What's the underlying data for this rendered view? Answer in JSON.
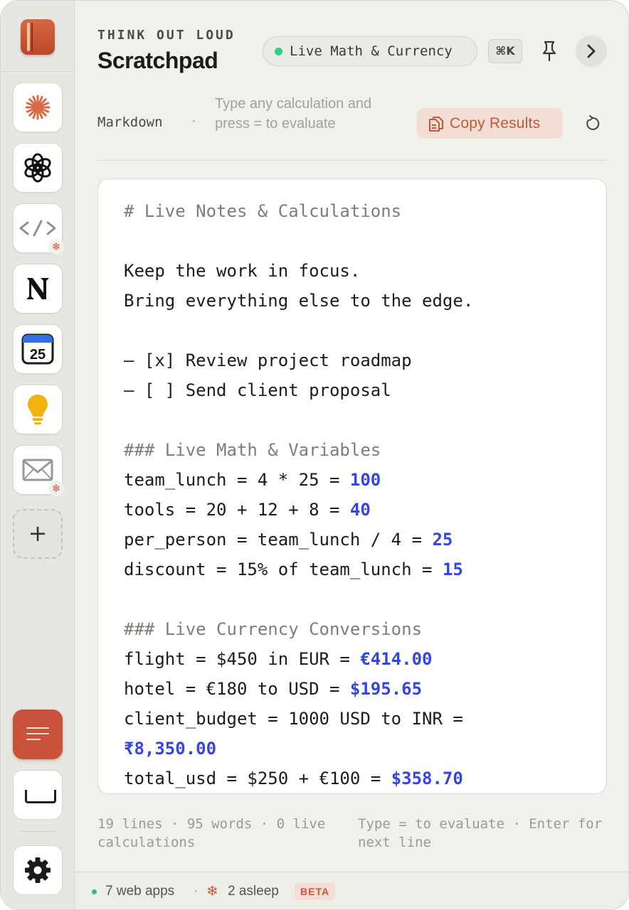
{
  "header": {
    "eyebrow": "THINK OUT LOUD",
    "title": "Scratchpad",
    "mode_label": "Live Math & Currency",
    "shortcut": "⌘K"
  },
  "toolbar": {
    "format": "Markdown",
    "separator": "·",
    "hint": "Type any calculation and press = to evaluate",
    "copy_label": "Copy Results"
  },
  "editor": {
    "lines": [
      {
        "text": "# Live Notes & Calculations",
        "result": "",
        "kind": "heading"
      },
      {
        "text": "",
        "result": "",
        "kind": "text"
      },
      {
        "text": "Keep the work in focus.",
        "result": "",
        "kind": "text"
      },
      {
        "text": "Bring everything else to the edge.",
        "result": "",
        "kind": "text"
      },
      {
        "text": "",
        "result": "",
        "kind": "text"
      },
      {
        "text": "– [x] Review project roadmap",
        "result": "",
        "kind": "text"
      },
      {
        "text": "– [ ] Send client proposal",
        "result": "",
        "kind": "text"
      },
      {
        "text": "",
        "result": "",
        "kind": "text"
      },
      {
        "text": "### Live Math & Variables",
        "result": "",
        "kind": "heading"
      },
      {
        "text": "team_lunch = 4 * 25 = ",
        "result": "100",
        "kind": "calc"
      },
      {
        "text": "tools = 20 + 12 + 8 = ",
        "result": "40",
        "kind": "calc"
      },
      {
        "text": "per_person = team_lunch / 4 = ",
        "result": "25",
        "kind": "calc"
      },
      {
        "text": "discount = 15% of team_lunch = ",
        "result": "15",
        "kind": "calc"
      },
      {
        "text": "",
        "result": "",
        "kind": "text"
      },
      {
        "text": "### Live Currency Conversions",
        "result": "",
        "kind": "heading"
      },
      {
        "text": "flight = $450 in EUR = ",
        "result": "€414.00",
        "kind": "calc"
      },
      {
        "text": "hotel = €180 to USD = ",
        "result": "$195.65",
        "kind": "calc"
      },
      {
        "text": "client_budget = 1000 USD to INR =",
        "result": "",
        "kind": "calc"
      },
      {
        "text": "",
        "result": "₹8,350.00",
        "kind": "calc"
      },
      {
        "text": "total_usd = $250 + €100 = ",
        "result": "$358.70",
        "kind": "calc"
      }
    ]
  },
  "status": {
    "stats_left": "19 lines  ·  95 words  ·  0 live calculations",
    "stats_right": "Type = to evaluate  ·  Enter for next line"
  },
  "footer": {
    "apps": "7 web apps",
    "separator": "·",
    "asleep": "2 asleep",
    "badge": "BETA"
  },
  "sidebar": {
    "apps": [
      {
        "name": "claude",
        "asleep": false
      },
      {
        "name": "chatgpt",
        "asleep": false
      },
      {
        "name": "dev-tools",
        "asleep": true
      },
      {
        "name": "notion",
        "asleep": false
      },
      {
        "name": "calendar",
        "asleep": false,
        "day": "25"
      },
      {
        "name": "ideas",
        "asleep": false
      },
      {
        "name": "mail",
        "asleep": true
      }
    ]
  },
  "colors": {
    "accent": "#c9533a",
    "result": "#3445e0",
    "live_dot": "#2fcf86"
  }
}
